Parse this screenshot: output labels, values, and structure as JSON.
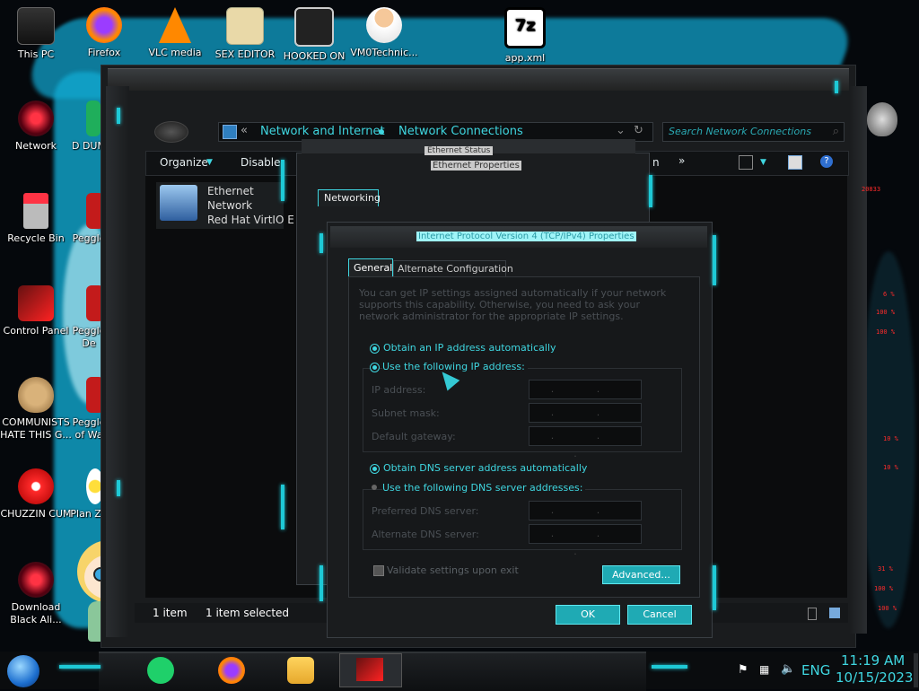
{
  "desktop": {
    "icons": [
      {
        "label": "This PC"
      },
      {
        "label": "Firefox"
      },
      {
        "label": "VLC media"
      },
      {
        "label": "SEX EDITOR"
      },
      {
        "label": "HOOKED ON"
      },
      {
        "label": "VM0Technic..."
      },
      {
        "label": "app.xml"
      },
      {
        "label": "Network"
      },
      {
        "label": "Recycle Bin"
      },
      {
        "label": "Control Panel"
      },
      {
        "label": "COMMUNISTS HATE THIS G..."
      },
      {
        "label": "CHUZZIN CUM"
      },
      {
        "label": "Download Black Ali..."
      },
      {
        "label": "Peggle"
      },
      {
        "label": "Peggle De"
      },
      {
        "label": "Peggle of Wa"
      },
      {
        "label": "Plan Zo"
      },
      {
        "label": "D DUM"
      }
    ]
  },
  "explorer": {
    "breadcrumb": {
      "seg1": "Network and Internet",
      "seg2": "Network Connections"
    },
    "search_placeholder": "Search Network Connections",
    "toolbar": {
      "organize": "Organize",
      "disable": "Disable",
      "more": "»",
      "n": "n"
    },
    "item": {
      "name": "Ethernet",
      "status": "Network",
      "adapter": "Red Hat VirtIO E"
    },
    "status": {
      "count": "1 item",
      "selected": "1 item selected"
    }
  },
  "ethernet_props": {
    "title": "Ethernet Properties",
    "status_title": "Ethernet Status",
    "tab": "Networking"
  },
  "ipv4": {
    "title": "Internet Protocol Version 4 (TCP/IPv4) Properties",
    "tabs": {
      "general": "General",
      "alternate": "Alternate Configuration"
    },
    "intro": "You can get IP settings assigned automatically if your network supports this capability. Otherwise, you need to ask your network administrator for the appropriate IP settings.",
    "ip_auto": "Obtain an IP address automatically",
    "ip_manual": "Use the following IP address:",
    "ip_address": "IP address:",
    "subnet": "Subnet mask:",
    "gateway": "Default gateway:",
    "dns_auto": "Obtain DNS server address automatically",
    "dns_manual": "Use the following DNS server addresses:",
    "dns_pref": "Preferred DNS server:",
    "dns_alt": "Alternate DNS server:",
    "validate": "Validate settings upon exit",
    "advanced": "Advanced...",
    "ok": "OK",
    "cancel": "Cancel",
    "ip_dots": ". . ."
  },
  "taskbar": {
    "lang": "ENG",
    "time": "11:19 AM",
    "date": "10/15/2023"
  },
  "colors": {
    "accent": "#1ec9d6",
    "bg": "#151719"
  }
}
